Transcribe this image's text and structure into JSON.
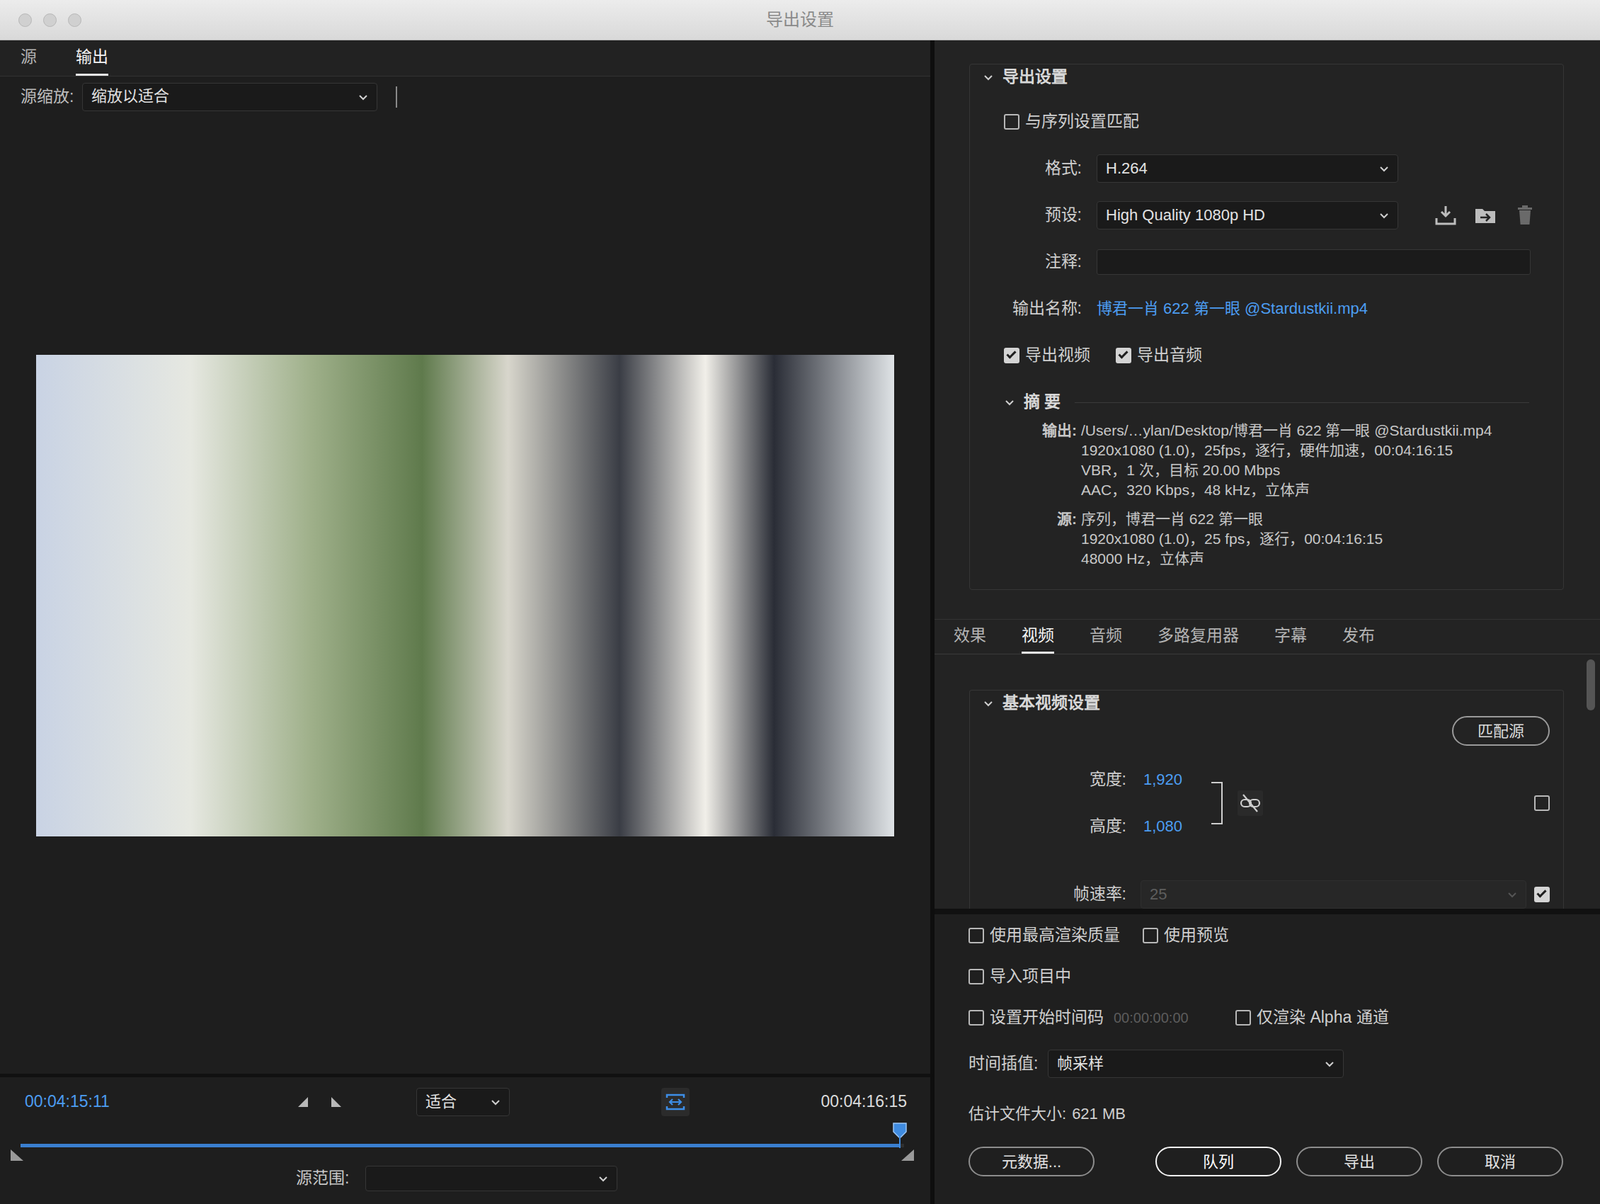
{
  "window": {
    "title": "导出设置"
  },
  "left_tabs": [
    {
      "label": "源",
      "selected": false
    },
    {
      "label": "输出",
      "selected": true
    }
  ],
  "source_scaling": {
    "label": "源缩放:",
    "value": "缩放以适合"
  },
  "timeline": {
    "current": "00:04:15:11",
    "zoom": "适合",
    "duration": "00:04:16:15",
    "level": 0.995,
    "source_range_label": "源范围:"
  },
  "export_settings": {
    "title": "导出设置",
    "expanded": true,
    "match_sequence": {
      "label": "与序列设置匹配",
      "checked": false
    },
    "format": {
      "label": "格式:",
      "value": "H.264"
    },
    "preset": {
      "label": "预设:",
      "value": "High Quality 1080p HD"
    },
    "comments": {
      "label": "注释:"
    },
    "output_name": {
      "label": "输出名称:",
      "value": "博君一肖 622 第一眼 @Stardustkii.mp4"
    },
    "export_video": {
      "label": "导出视频",
      "checked": true
    },
    "export_audio": {
      "label": "导出音频",
      "checked": true
    },
    "summary": {
      "title": "摘 要",
      "expanded": true,
      "output_label": "输出:",
      "output_lines": [
        "/Users/…ylan/Desktop/博君一肖 622 第一眼 @Stardustkii.mp4",
        "1920x1080 (1.0)，25fps，逐行，硬件加速，00:04:16:15",
        "VBR，1 次，目标 20.00 Mbps",
        "AAC，320 Kbps，48  kHz，立体声"
      ],
      "source_label": "源:",
      "source_lines": [
        "序列，博君一肖 622 第一眼",
        "1920x1080 (1.0)，25 fps，逐行，00:04:16:15",
        "48000 Hz，立体声"
      ]
    }
  },
  "settings_tabs": [
    {
      "label": "效果",
      "selected": false
    },
    {
      "label": "视频",
      "selected": true
    },
    {
      "label": "音频",
      "selected": false
    },
    {
      "label": "多路复用器",
      "selected": false
    },
    {
      "label": "字幕",
      "selected": false
    },
    {
      "label": "发布",
      "selected": false
    }
  ],
  "video": {
    "title": "基本视频设置",
    "expanded": true,
    "match_source": "匹配源",
    "width": {
      "label": "宽度:",
      "value": "1,920"
    },
    "height": {
      "label": "高度:",
      "value": "1,080"
    },
    "linked": false,
    "resize_checked": false,
    "frame_rate": {
      "label": "帧速率:",
      "value": "25",
      "disabled": true,
      "checked": true
    }
  },
  "render_rows": [
    [
      {
        "label": "使用最高渲染质量",
        "checked": false
      },
      {
        "label": "使用预览",
        "checked": false
      }
    ],
    [
      {
        "label": "导入项目中",
        "checked": false
      }
    ],
    [
      {
        "label": "设置开始时间码",
        "checked": false,
        "value": "00:00:00:00",
        "value_disabled": true
      },
      {
        "label": "仅渲染 Alpha 通道",
        "checked": false
      }
    ]
  ],
  "time_interpolation": {
    "label": "时间插值:",
    "value": "帧采样"
  },
  "file_size": {
    "label": "估计文件大小:",
    "value": "621 MB"
  },
  "buttons": [
    {
      "label": "元数据...",
      "primary": false
    },
    {
      "label": "队列",
      "primary": true
    },
    {
      "label": "导出",
      "primary": false
    },
    {
      "label": "取消",
      "primary": false
    }
  ]
}
